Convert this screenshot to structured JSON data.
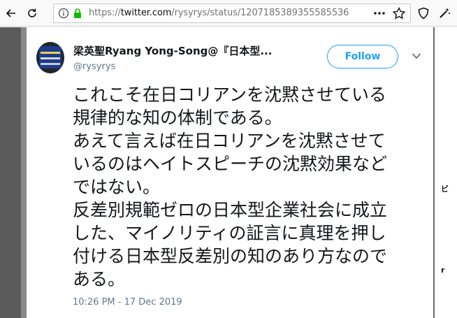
{
  "browser": {
    "url_prefix": "https://",
    "url_host": "twitter.com",
    "url_path": "/rysyrys/status/1207185389355585536"
  },
  "tweet": {
    "author_name": "梁英聖Ryang Yong-Song@『日本型...",
    "author_handle": "@rysyrys",
    "follow_label": "Follow",
    "text_lines": [
      "これこそ在日コリアンを沈黙させている",
      "規律的な知の体制である。",
      "あえて言えば在日コリアンを沈黙させて",
      "いるのはヘイトスピーチの沈黙効果など",
      "ではない。",
      "反差別規範ゼロの日本型企業社会に成立",
      "した、マイノリティの証言に真理を押し",
      "付ける日本型反差別の知のあり方なので",
      "ある。"
    ],
    "timestamp": "10:26 PM - 17 Dec 2019"
  },
  "colors": {
    "accent": "#1da1f2",
    "text": "#14171a",
    "secondary": "#657786",
    "lock": "#12bc00"
  }
}
